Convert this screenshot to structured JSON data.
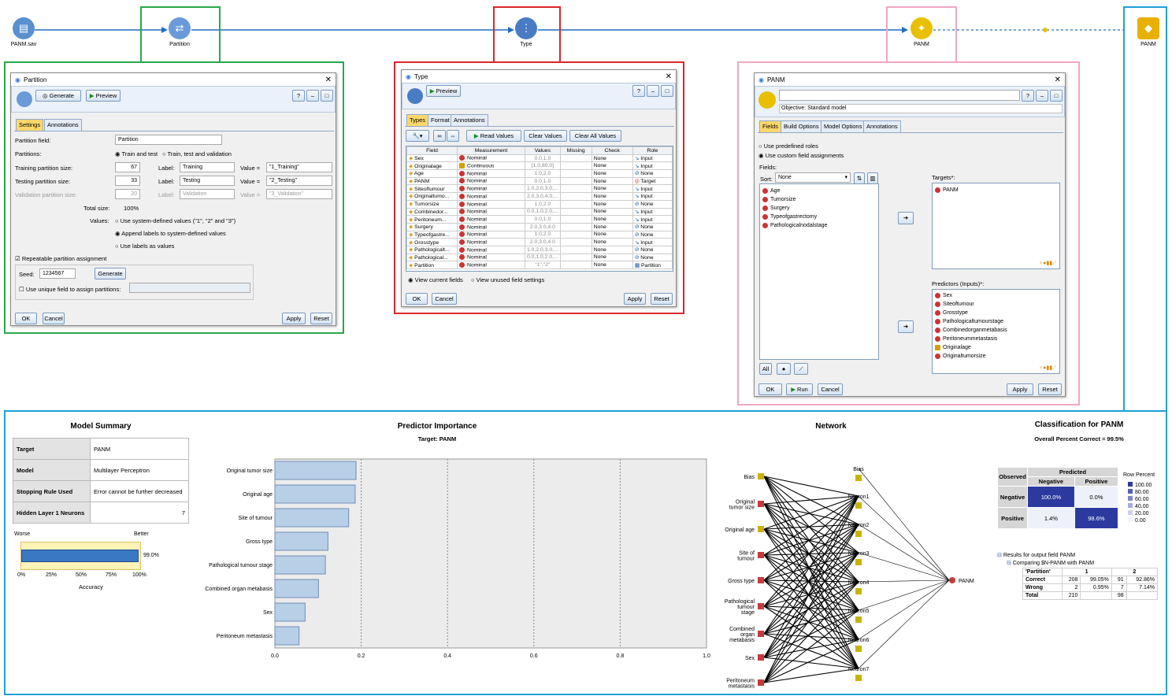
{
  "stream": {
    "nodes": [
      {
        "name": "PANM.sav"
      },
      {
        "name": "Partition"
      },
      {
        "name": "Type"
      },
      {
        "name": "PANM"
      },
      {
        "name": "PANM"
      }
    ]
  },
  "partition": {
    "title": "Partition",
    "generate": "Generate",
    "preview": "Preview",
    "tabs": [
      "Settings",
      "Annotations"
    ],
    "field_label": "Partition field:",
    "field_value": "Partition",
    "partitions_label": "Partitions:",
    "opt_train_test": "Train and test",
    "opt_ttv": "Train, test and validation",
    "rows": [
      {
        "label": "Training partition size:",
        "size": "67",
        "lab": "Label:",
        "labval": "Training",
        "val": "Value =",
        "value": "\"1_Training\""
      },
      {
        "label": "Testing partition size:",
        "size": "33",
        "lab": "Label:",
        "labval": "Testing",
        "val": "Value =",
        "value": "\"2_Testing\""
      },
      {
        "label": "Validation partition size:",
        "size": "20",
        "lab": "Label:",
        "labval": "Validation",
        "val": "Value =",
        "value": "\"3_Validation\""
      }
    ],
    "total_label": "Total size:",
    "total_value": "100%",
    "values_label": "Values:",
    "values_opts": [
      "Use system-defined values (\"1\", \"2\" and \"3\")",
      "Append labels to system-defined values",
      "Use labels as values"
    ],
    "repeatable": "Repeatable partition assignment",
    "seed_label": "Seed:",
    "seed_value": "1234567",
    "seed_generate": "Generate",
    "unique_field": "Use unique field to assign partitions:",
    "ok": "OK",
    "cancel": "Cancel",
    "apply": "Apply",
    "reset": "Reset"
  },
  "type": {
    "title": "Type",
    "preview": "Preview",
    "tabs": [
      "Types",
      "Format",
      "Annotations"
    ],
    "read_values": "Read Values",
    "clear_values": "Clear Values",
    "clear_all": "Clear All Values",
    "columns": [
      "Field",
      "Measurement",
      "Values",
      "Missing",
      "Check",
      "Role"
    ],
    "rows": [
      {
        "field": "Sex",
        "meas": "Nominal",
        "values": "0.0,1.0",
        "check": "None",
        "role": "Input"
      },
      {
        "field": "Originalage",
        "meas": "Continuous",
        "values": "[1.0,80.0]",
        "check": "None",
        "role": "Input"
      },
      {
        "field": "Age",
        "meas": "Nominal",
        "values": "1.0,2.0",
        "check": "None",
        "role": "None"
      },
      {
        "field": "PANM",
        "meas": "Nominal",
        "values": "0.0,1.0",
        "check": "None",
        "role": "Target"
      },
      {
        "field": "Siteoftumour",
        "meas": "Nominal",
        "values": "1.0,2.0,3.0,...",
        "check": "None",
        "role": "Input"
      },
      {
        "field": "Originaltumo...",
        "meas": "Nominal",
        "values": "2.0,3.0,4.0,...",
        "check": "None",
        "role": "Input"
      },
      {
        "field": "Tumorsize",
        "meas": "Nominal",
        "values": "1.0,2.0",
        "check": "None",
        "role": "None"
      },
      {
        "field": "Combinedor...",
        "meas": "Nominal",
        "values": "0.0,1.0,2.0,...",
        "check": "None",
        "role": "Input"
      },
      {
        "field": "Peritoneum...",
        "meas": "Nominal",
        "values": "0.0,1.0",
        "check": "None",
        "role": "Input"
      },
      {
        "field": "Surgery",
        "meas": "Nominal",
        "values": "2.0,3.0,4.0",
        "check": "None",
        "role": "None"
      },
      {
        "field": "Typeofgastre...",
        "meas": "Nominal",
        "values": "1.0,2.0",
        "check": "None",
        "role": "None"
      },
      {
        "field": "Grosstype",
        "meas": "Nominal",
        "values": "2.0,3.0,4.0",
        "check": "None",
        "role": "Input"
      },
      {
        "field": "Pathologicalt...",
        "meas": "Nominal",
        "values": "1.0,2.0,3.0,...",
        "check": "None",
        "role": "None"
      },
      {
        "field": "Pathological...",
        "meas": "Nominal",
        "values": "0.0,1.0,2.0,...",
        "check": "None",
        "role": "None"
      },
      {
        "field": "Partition",
        "meas": "Nominal",
        "values": "\"1\",\"2\"",
        "check": "None",
        "role": "Partition"
      }
    ],
    "view_current": "View current fields",
    "view_unused": "View unused field settings",
    "ok": "OK",
    "cancel": "Cancel",
    "apply": "Apply",
    "reset": "Reset"
  },
  "panm": {
    "title": "PANM",
    "objective": "Objective: Standard model",
    "tabs": [
      "Fields",
      "Build Options",
      "Model Options",
      "Annotations"
    ],
    "use_predefined": "Use predefined roles",
    "use_custom": "Use custom field assignments",
    "fields_label": "Fields:",
    "sort_label": "Sort:",
    "sort_value": "None",
    "fields": [
      "Age",
      "Tumorsize",
      "Surgery",
      "Typeofgastrectomy",
      "Pathologicalnodalstage"
    ],
    "targets_label": "Targets*:",
    "targets": [
      "PANM"
    ],
    "predictors_label": "Predictors (Inputs)*:",
    "predictors": [
      "Sex",
      "Siteoftumour",
      "Grosstype",
      "Pathologicaltumourstage",
      "Combinedorganmetabasis",
      "Peritoneummetastasis",
      "Originalage",
      "Originaltumorsize"
    ],
    "all": "All",
    "ok": "OK",
    "run": "Run",
    "cancel": "Cancel",
    "apply": "Apply",
    "reset": "Reset"
  },
  "model_summary": {
    "title": "Model Summary",
    "rows": [
      {
        "k": "Target",
        "v": "PANM"
      },
      {
        "k": "Model",
        "v": "Multilayer Perceptron"
      },
      {
        "k": "Stopping Rule Used",
        "v": "Error cannot be further decreased"
      },
      {
        "k": "Hidden Layer 1 Neurons",
        "v": "7"
      }
    ],
    "worse": "Worse",
    "better": "Better",
    "accuracy_value": "99.0%",
    "accuracy_fraction": 0.99,
    "ticks": [
      "0%",
      "25%",
      "50%",
      "75%",
      "100%"
    ],
    "accuracy_label": "Accuracy"
  },
  "chart_data": {
    "type": "bar",
    "title": "Predictor Importance",
    "subtitle": "Target: PANM",
    "categories": [
      "Original tumor size",
      "Original age",
      "Site of tumour",
      "Gross type",
      "Pathological tumour stage",
      "Combined organ metabasis",
      "Sex",
      "Peritoneum metastasis"
    ],
    "values": [
      0.188,
      0.186,
      0.171,
      0.123,
      0.117,
      0.101,
      0.07,
      0.056
    ],
    "xlim": [
      0,
      1
    ],
    "xticks": [
      "0.0",
      "0.2",
      "0.4",
      "0.6",
      "0.8",
      "1.0"
    ],
    "bar_color": "#b8cfe8"
  },
  "network": {
    "title": "Network",
    "inputs": [
      "Bias",
      "Original tumor size",
      "Original age",
      "Site of tumour",
      "Gross type",
      "Pathological tumour stage",
      "Combined organ metabasis",
      "Sex",
      "Peritoneum metastasis"
    ],
    "hidden": [
      "Bias",
      "Neuron1",
      "Neuron2",
      "Neuron3",
      "Neuron4",
      "Neuron5",
      "Neuron6",
      "Neuron7"
    ],
    "output": "PANM"
  },
  "classification": {
    "title": "Classification for PANM",
    "overall": "Overall Percent Correct = 99.5%",
    "predicted": "Predicted",
    "observed": "Observed",
    "cols": [
      "Negative",
      "Positive"
    ],
    "rows": [
      {
        "label": "Negative",
        "cells": [
          "100.0%",
          "0.0%"
        ]
      },
      {
        "label": "Positive",
        "cells": [
          "1.4%",
          "98.6%"
        ]
      }
    ],
    "legend_title": "Row Percent",
    "legend": [
      "100.00",
      "80.00",
      "60.00",
      "40.00",
      "20.00",
      "0.00"
    ]
  },
  "results": {
    "line1": "Results for output field PANM",
    "line2": "Comparing $N-PANM with PANM",
    "head": [
      "'Partition'",
      "1",
      "",
      "2",
      ""
    ],
    "rows": [
      [
        "Correct",
        "208",
        "99.05%",
        "91",
        "92.86%"
      ],
      [
        "Wrong",
        "2",
        "0.95%",
        "7",
        "7.14%"
      ],
      [
        "Total",
        "210",
        "",
        "98",
        ""
      ]
    ]
  }
}
